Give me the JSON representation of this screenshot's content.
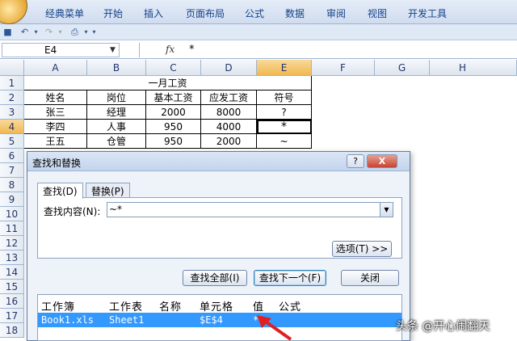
{
  "ribbon": {
    "tabs": [
      "经典菜单",
      "开始",
      "插入",
      "页面布局",
      "公式",
      "数据",
      "审阅",
      "视图",
      "开发工具"
    ]
  },
  "formula_bar": {
    "name_box": "E4",
    "fx": "fx",
    "value": "*"
  },
  "columns": [
    "A",
    "B",
    "C",
    "D",
    "E",
    "F",
    "G",
    "H"
  ],
  "rows": [
    "1",
    "2",
    "3",
    "4",
    "5",
    "6",
    "7",
    "8",
    "9",
    "10",
    "11",
    "12",
    "13",
    "14",
    "15",
    "16",
    "17",
    "18"
  ],
  "sheet": {
    "title": "一月工资",
    "headers": [
      "姓名",
      "岗位",
      "基本工资",
      "应发工资",
      "符号"
    ],
    "data": [
      [
        "张三",
        "经理",
        "2000",
        "8000",
        "?"
      ],
      [
        "李四",
        "人事",
        "950",
        "4000",
        "*"
      ],
      [
        "王五",
        "仓管",
        "950",
        "2000",
        "~"
      ]
    ]
  },
  "dialog": {
    "title": "查找和替换",
    "help": "?",
    "close": "X",
    "tab_find": "查找(D)",
    "tab_replace": "替换(P)",
    "find_label": "查找内容(N):",
    "find_value": "~*",
    "options": "选项(T) >>",
    "find_all": "查找全部(I)",
    "find_next": "查找下一个(F)",
    "close_btn": "关闭",
    "result_headers": [
      "工作簿",
      "工作表",
      "名称",
      "单元格",
      "值",
      "公式"
    ],
    "result_row": {
      "book": "Book1.xls",
      "sheet": "Sheet1",
      "name": "",
      "cell": "$E$4",
      "value": "*",
      "formula": ""
    }
  },
  "watermark": "头条 @开心闹翻天"
}
